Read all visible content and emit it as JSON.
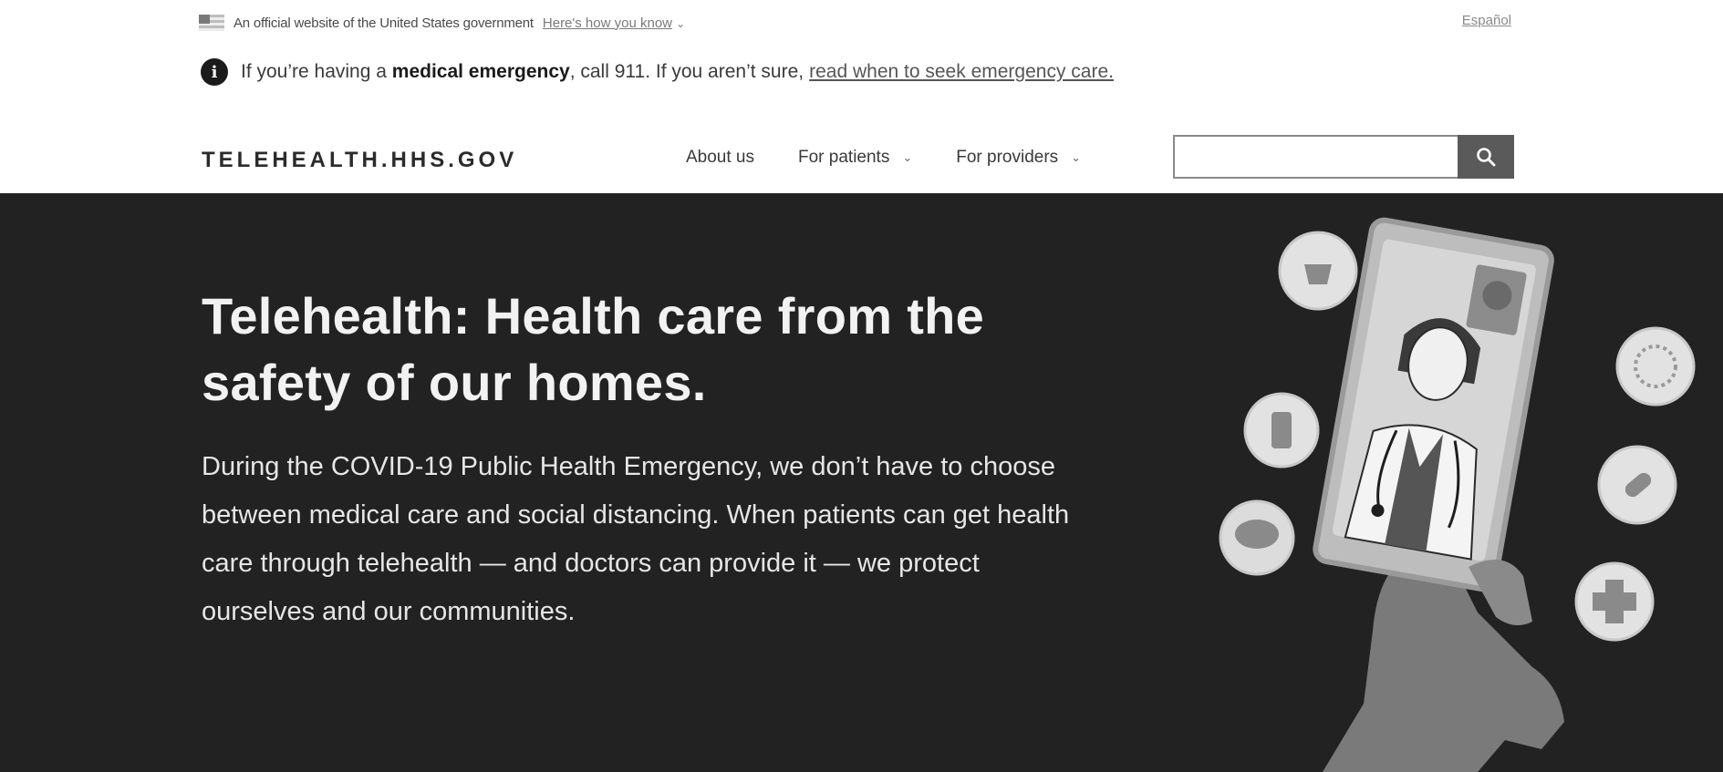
{
  "gov_banner": {
    "official_text": "An official website of the United States government",
    "how_you_know": "Here's how you know",
    "language_link": "Español"
  },
  "emergency": {
    "prefix": "If you’re having a ",
    "bold": "medical emergency",
    "suffix": ", call 911. If you aren’t sure, ",
    "link": "read when to seek emergency care."
  },
  "header": {
    "logo": "TELEHEALTH.HHS.GOV",
    "nav": [
      {
        "label": "About us",
        "has_dropdown": false
      },
      {
        "label": "For patients",
        "has_dropdown": true
      },
      {
        "label": "For providers",
        "has_dropdown": true
      }
    ],
    "search": {
      "placeholder": "",
      "value": ""
    }
  },
  "hero": {
    "title": "Telehealth: Health care from the safety of our homes.",
    "body": "During the COVID-19 Public Health Emergency, we don’t have to choose between medical care and social distancing. When patients can get health care through telehealth — and doctors can provide it — we protect ourselves and our communities."
  },
  "colors": {
    "hero_background": "#222222",
    "search_button": "#5a5a5a",
    "text_dark": "#1b1b1b"
  }
}
